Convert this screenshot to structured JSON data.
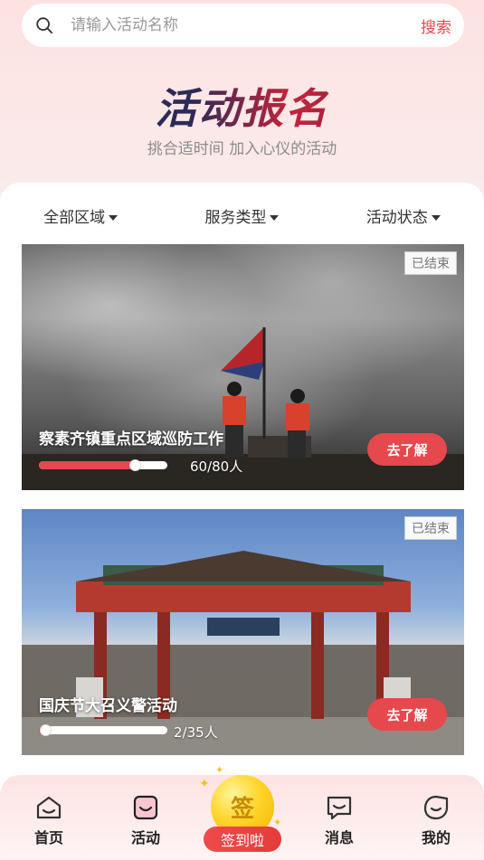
{
  "search": {
    "placeholder": "请输入活动名称",
    "button_label": "搜索"
  },
  "hero": {
    "title": "活动报名",
    "subtitle": "挑合适时间  加入心仪的活动"
  },
  "filters": [
    {
      "label": "全部区域"
    },
    {
      "label": "服务类型"
    },
    {
      "label": "活动状态"
    }
  ],
  "activities": [
    {
      "title": "察素齐镇重点区域巡防工作",
      "status": "已结束",
      "enrolled": 60,
      "capacity": 80,
      "progress_text": "60/80人",
      "action_label": "去了解"
    },
    {
      "title": "国庆节大召义警活动",
      "status": "已结束",
      "enrolled": 2,
      "capacity": 35,
      "progress_text": "2/35人",
      "action_label": "去了解"
    }
  ],
  "tabbar": {
    "home": "首页",
    "activity": "活动",
    "sign_icon_text": "签",
    "sign_label": "签到啦",
    "message": "消息",
    "mine": "我的"
  },
  "colors": {
    "accent": "#e5484d",
    "coin": "#ffd42a"
  }
}
